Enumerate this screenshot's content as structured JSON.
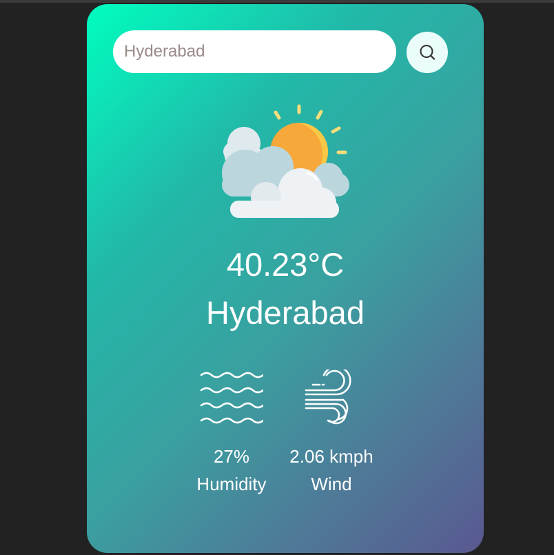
{
  "search": {
    "value": "",
    "placeholder": "Hyderabad"
  },
  "icons": {
    "search_button": "search-icon",
    "weather": "partly-cloudy-sun-icon",
    "humidity": "humidity-waves-icon",
    "wind": "wind-icon"
  },
  "weather": {
    "temperature": "40.23°C",
    "city": "Hyderabad"
  },
  "stats": {
    "humidity": {
      "value": "27%",
      "label": "Humidity"
    },
    "wind": {
      "value": "2.06 kmph",
      "label": "Wind"
    }
  },
  "colors": {
    "background": "#222222",
    "card_gradient_start": "#00fec0",
    "card_gradient_end": "#5a5890",
    "text": "#ffffff",
    "sun": "#f9c846",
    "sun_shade": "#f7a83a",
    "cloud_light": "#eef2f4",
    "cloud_blue": "#bcd6de"
  }
}
